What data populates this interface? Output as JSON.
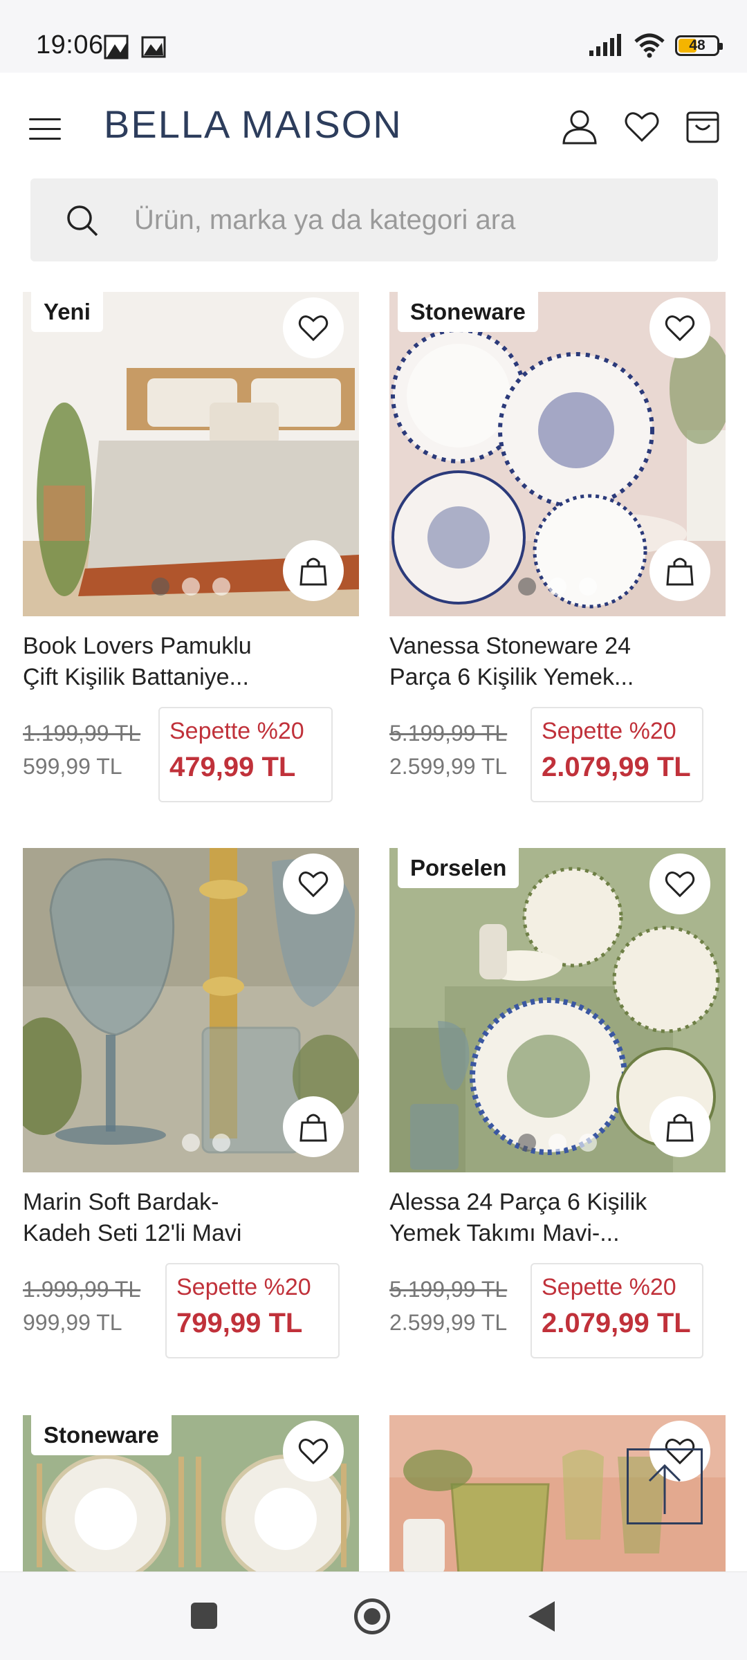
{
  "status_bar": {
    "time": "19:06",
    "battery": "48",
    "icons": [
      "signal-icon",
      "wifi-icon",
      "battery-icon"
    ]
  },
  "header": {
    "logo": "BELLA MAISON",
    "icons": [
      "menu-icon",
      "user-icon",
      "heart-icon",
      "cart-icon"
    ]
  },
  "search": {
    "placeholder": "Ürün, marka ya da kategori ara"
  },
  "products": [
    {
      "tag": "Yeni",
      "title_line1": "Book Lovers Pamuklu",
      "title_line2": "Çift Kişilik Battaniye...",
      "old_price": "1.199,99 TL",
      "price": "599,99 TL",
      "promo_label": "Sepette %20",
      "promo_price": "479,99 TL"
    },
    {
      "tag": "Stoneware",
      "title_line1": "Vanessa Stoneware 24",
      "title_line2": "Parça 6 Kişilik Yemek...",
      "old_price": "5.199,99 TL",
      "price": "2.599,99 TL",
      "promo_label": "Sepette %20",
      "promo_price": "2.079,99 TL"
    },
    {
      "tag": "",
      "title_line1": "Marin Soft Bardak-",
      "title_line2": "Kadeh Seti 12'li Mavi",
      "old_price": "1.999,99 TL",
      "price": "999,99 TL",
      "promo_label": "Sepette %20",
      "promo_price": "799,99 TL"
    },
    {
      "tag": "Porselen",
      "title_line1": "Alessa 24 Parça 6 Kişilik",
      "title_line2": "Yemek Takımı Mavi-...",
      "old_price": "5.199,99 TL",
      "price": "2.599,99 TL",
      "promo_label": "Sepette %20",
      "promo_price": "2.079,99 TL"
    },
    {
      "tag": "Stoneware"
    },
    {
      "tag": ""
    }
  ],
  "colors": {
    "brand": "#2d3d5c",
    "promo": "#c0313a",
    "search_bg": "#efefef"
  }
}
